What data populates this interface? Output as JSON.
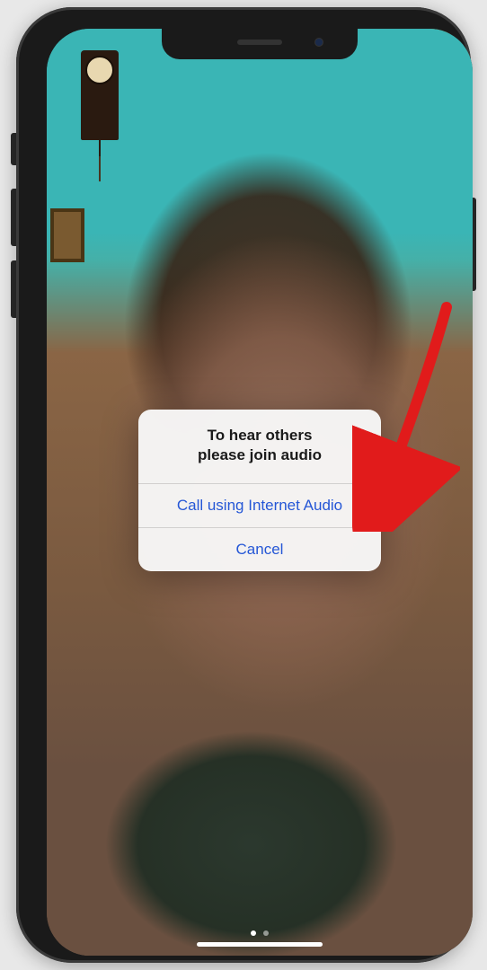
{
  "dialog": {
    "message_line1": "To hear others",
    "message_line2": "please join audio",
    "primary_action": "Call using Internet Audio",
    "cancel_action": "Cancel"
  },
  "colors": {
    "ios_blue": "#2557d6",
    "annotation_red": "#e11b1b"
  }
}
